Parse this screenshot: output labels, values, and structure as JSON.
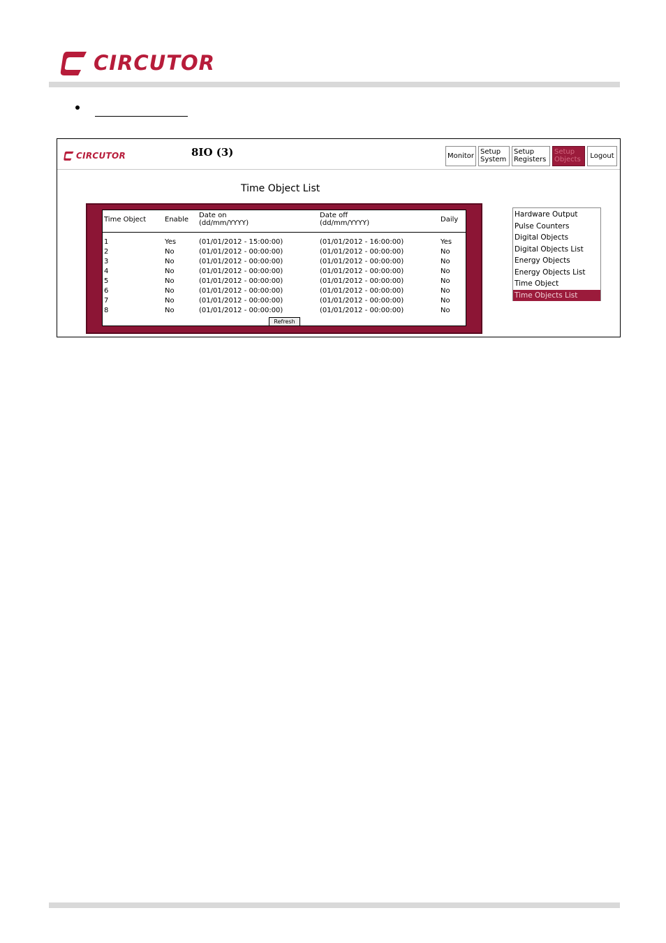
{
  "doc": {
    "brand": "CIRCUTOR"
  },
  "device": {
    "brand": "CIRCUTOR",
    "title": "8IO (3)"
  },
  "nav": [
    {
      "line1": "Monitor",
      "line2": ""
    },
    {
      "line1": "Setup",
      "line2": "System"
    },
    {
      "line1": "Setup",
      "line2": "Registers"
    },
    {
      "line1": "Setup",
      "line2": "Objects"
    },
    {
      "line1": "Logout",
      "line2": ""
    }
  ],
  "page": {
    "heading": "Time Object List"
  },
  "table": {
    "headers": {
      "time_object": "Time Object",
      "enable": "Enable",
      "date_on_1": "Date on",
      "date_on_2": "(dd/mm/YYYY)",
      "date_off_1": "Date off",
      "date_off_2": "(dd/mm/YYYY)",
      "daily": "Daily"
    },
    "rows": [
      {
        "id": "1",
        "enable": "Yes",
        "on": "(01/01/2012 - 15:00:00)",
        "off": "(01/01/2012 - 16:00:00)",
        "daily": "Yes"
      },
      {
        "id": "2",
        "enable": "No",
        "on": "(01/01/2012 - 00:00:00)",
        "off": "(01/01/2012 - 00:00:00)",
        "daily": "No"
      },
      {
        "id": "3",
        "enable": "No",
        "on": "(01/01/2012 - 00:00:00)",
        "off": "(01/01/2012 - 00:00:00)",
        "daily": "No"
      },
      {
        "id": "4",
        "enable": "No",
        "on": "(01/01/2012 - 00:00:00)",
        "off": "(01/01/2012 - 00:00:00)",
        "daily": "No"
      },
      {
        "id": "5",
        "enable": "No",
        "on": "(01/01/2012 - 00:00:00)",
        "off": "(01/01/2012 - 00:00:00)",
        "daily": "No"
      },
      {
        "id": "6",
        "enable": "No",
        "on": "(01/01/2012 - 00:00:00)",
        "off": "(01/01/2012 - 00:00:00)",
        "daily": "No"
      },
      {
        "id": "7",
        "enable": "No",
        "on": "(01/01/2012 - 00:00:00)",
        "off": "(01/01/2012 - 00:00:00)",
        "daily": "No"
      },
      {
        "id": "8",
        "enable": "No",
        "on": "(01/01/2012 - 00:00:00)",
        "off": "(01/01/2012 - 00:00:00)",
        "daily": "No"
      }
    ],
    "refresh_label": "Refresh"
  },
  "menu": [
    "Hardware Output",
    "Pulse Counters",
    "Digital Objects",
    "Digital Objects List",
    "Energy Objects",
    "Energy Objects List",
    "Time Object",
    "Time Objects List"
  ],
  "colors": {
    "brand": "#b71c3a",
    "active": "#9b1b3b",
    "panel": "#8c1535"
  }
}
